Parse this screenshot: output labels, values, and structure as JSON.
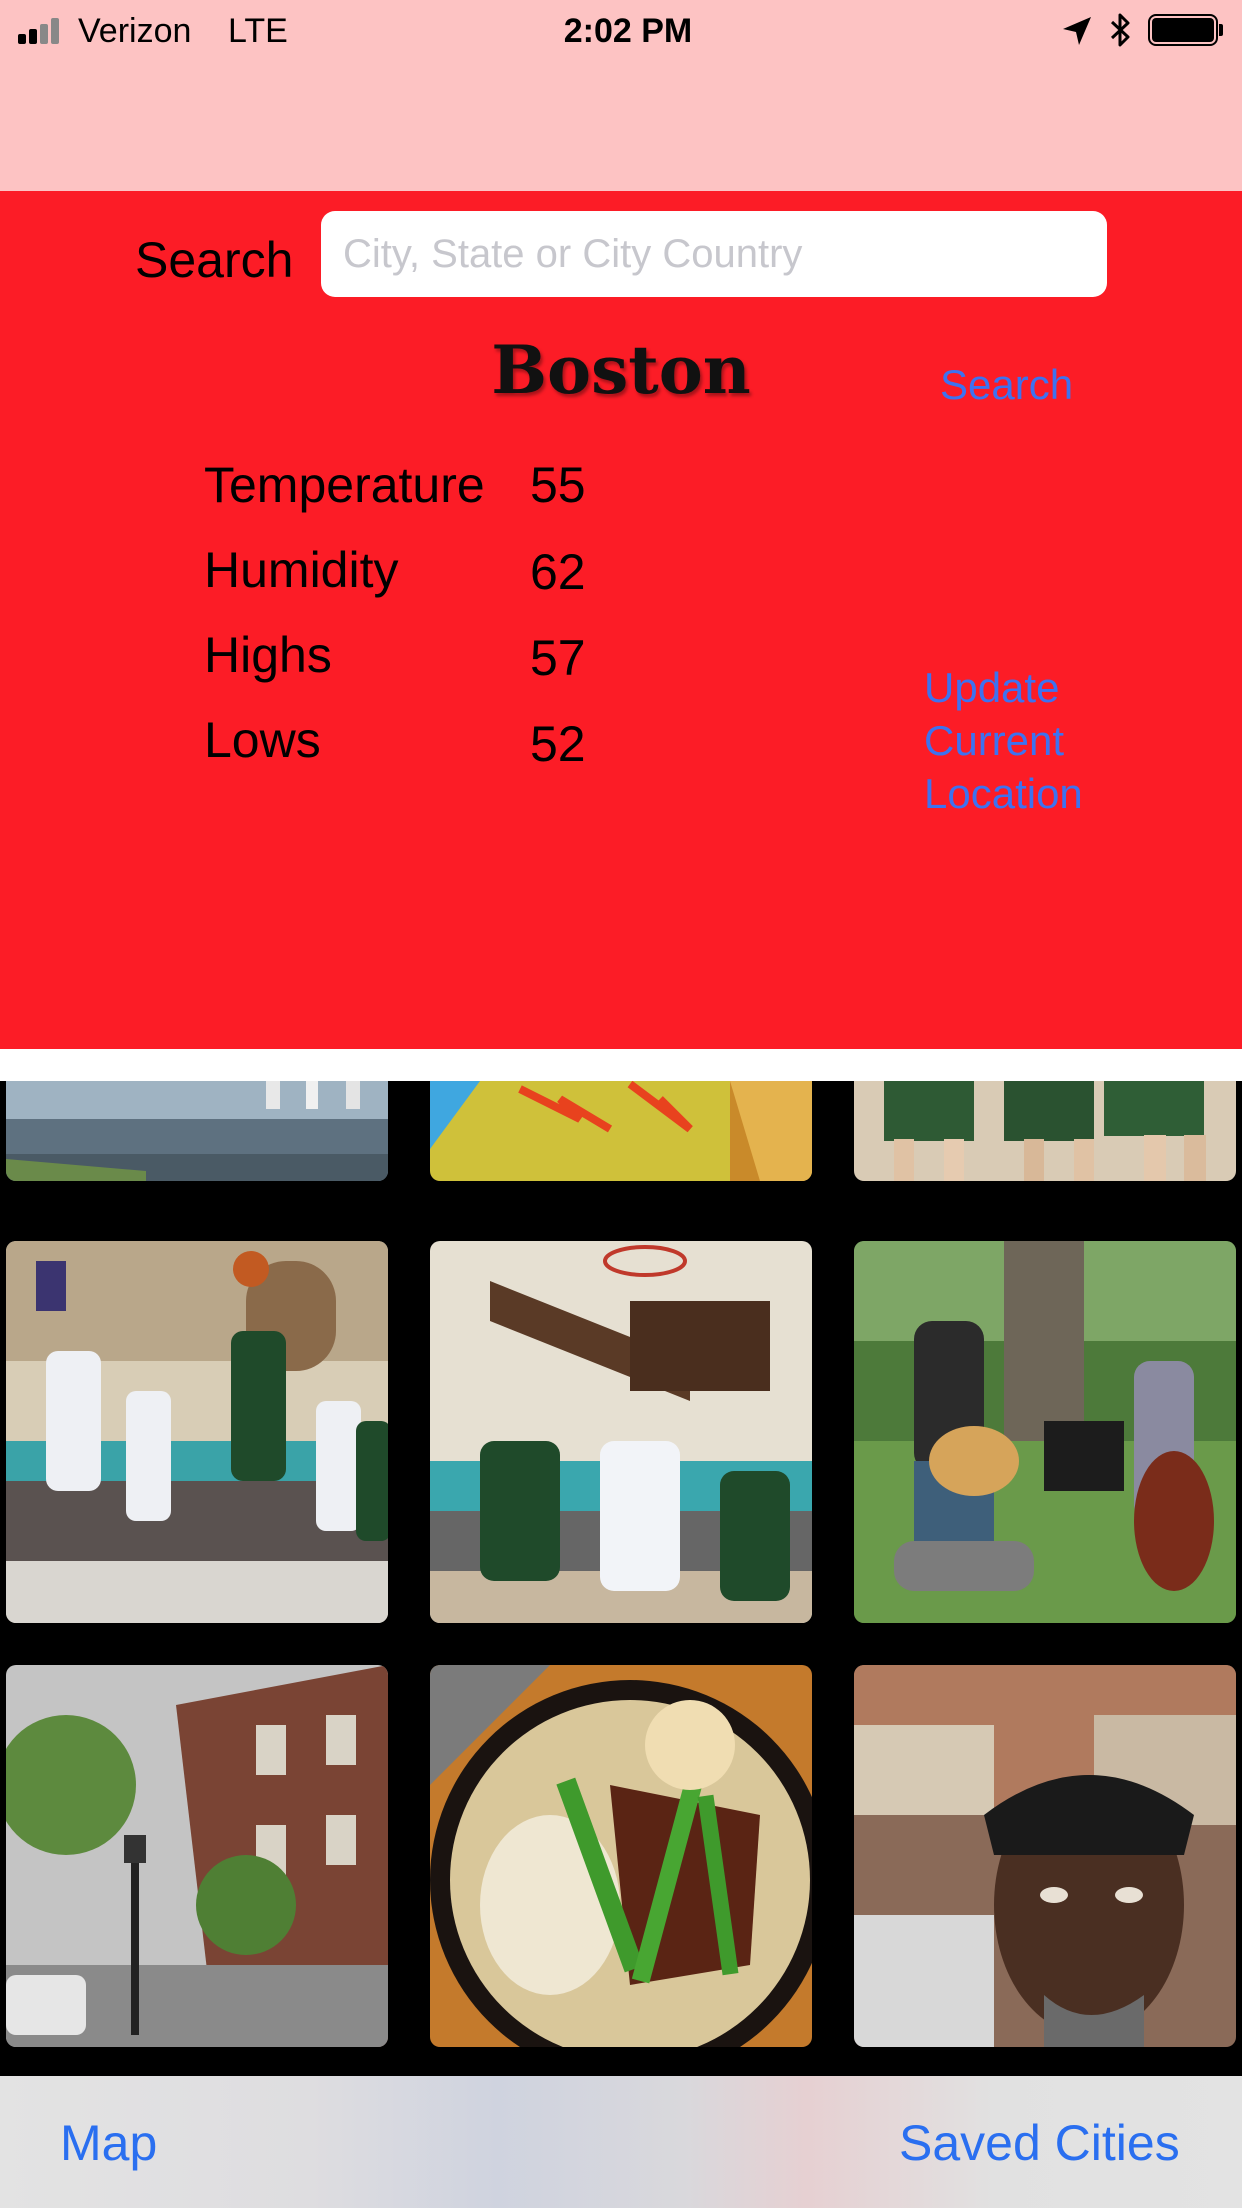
{
  "status_bar": {
    "carrier": "Verizon",
    "network": "LTE",
    "time": "2:02 PM"
  },
  "search": {
    "label": "Search",
    "placeholder": "City, State or City Country",
    "value": "",
    "button_label": "Search"
  },
  "weather": {
    "city": "Boston",
    "stats": [
      {
        "label": "Temperature",
        "value": "55"
      },
      {
        "label": "Humidity",
        "value": "62"
      },
      {
        "label": "Highs",
        "value": "57"
      },
      {
        "label": "Lows",
        "value": "52"
      }
    ],
    "update_button_lines": [
      "Update",
      "Current",
      "Location"
    ]
  },
  "photos": [
    "canal-boats-photo",
    "yellow-pennant-photo",
    "basketball-legs-photo",
    "basketball-shot-photo",
    "basketball-rebound-photo",
    "park-musicians-photo",
    "brownstone-street-photo",
    "ramen-bowl-photo",
    "man-portrait-photo"
  ],
  "toolbar": {
    "map_label": "Map",
    "saved_label": "Saved Cities"
  },
  "colors": {
    "nav_background": "#fdc3c3",
    "panel_red": "#fc1c26",
    "link_blue": "#3d72f0"
  }
}
